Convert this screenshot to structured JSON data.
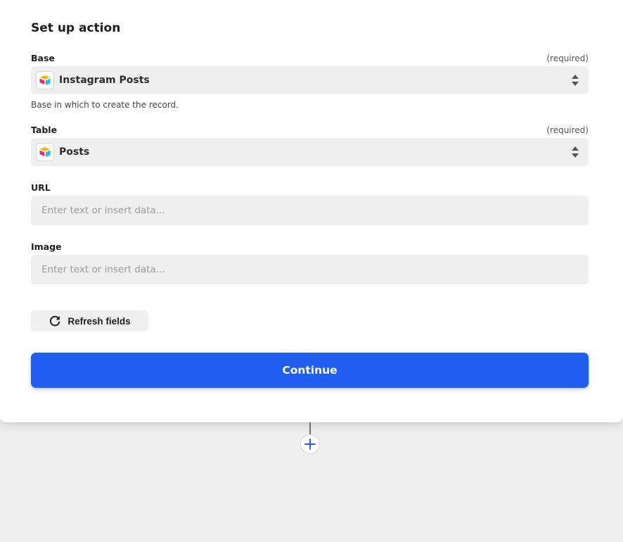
{
  "section": {
    "title": "Set up action"
  },
  "fields": {
    "base": {
      "label": "Base",
      "required": "(required)",
      "value": "Instagram Posts",
      "help": "Base in which to create the record.",
      "icon": "airtable-icon"
    },
    "table": {
      "label": "Table",
      "required": "(required)",
      "value": "Posts",
      "icon": "airtable-icon"
    },
    "url": {
      "label": "URL",
      "value": "",
      "placeholder": "Enter text or insert data..."
    },
    "image": {
      "label": "Image",
      "value": "",
      "placeholder": "Enter text or insert data..."
    }
  },
  "actions": {
    "refresh_label": "Refresh fields",
    "refresh_icon": "refresh-icon",
    "continue_label": "Continue",
    "add_step_icon": "plus-icon"
  },
  "colors": {
    "primary": "#1f5ef0",
    "field_bg": "#efefef",
    "canvas_bg": "#efefef"
  }
}
